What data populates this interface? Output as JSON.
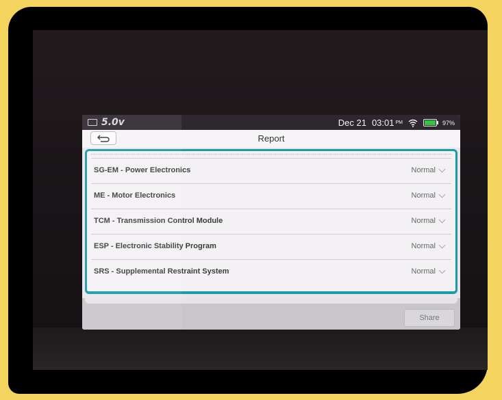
{
  "status_bar": {
    "voltage": "5.0v",
    "date": "Dec 21",
    "time": "03:01",
    "ampm": "PM",
    "battery_percent": "97%",
    "battery_level": 0.97
  },
  "header": {
    "title": "Report",
    "back_icon": "back-arrow-icon"
  },
  "modules": [
    {
      "label": "SG-EM - Power Electronics",
      "status": "Normal"
    },
    {
      "label": "ME - Motor Electronics",
      "status": "Normal"
    },
    {
      "label": "TCM - Transmission Control Module",
      "status": "Normal"
    },
    {
      "label": "ESP - Electronic Stability Program",
      "status": "Normal"
    },
    {
      "label": "SRS - Supplemental Restraint System",
      "status": "Normal"
    }
  ],
  "footer": {
    "share_label": "Share"
  },
  "colors": {
    "accent": "#1b9aa8",
    "battery": "#37c244",
    "frame": "#f4d35e"
  }
}
